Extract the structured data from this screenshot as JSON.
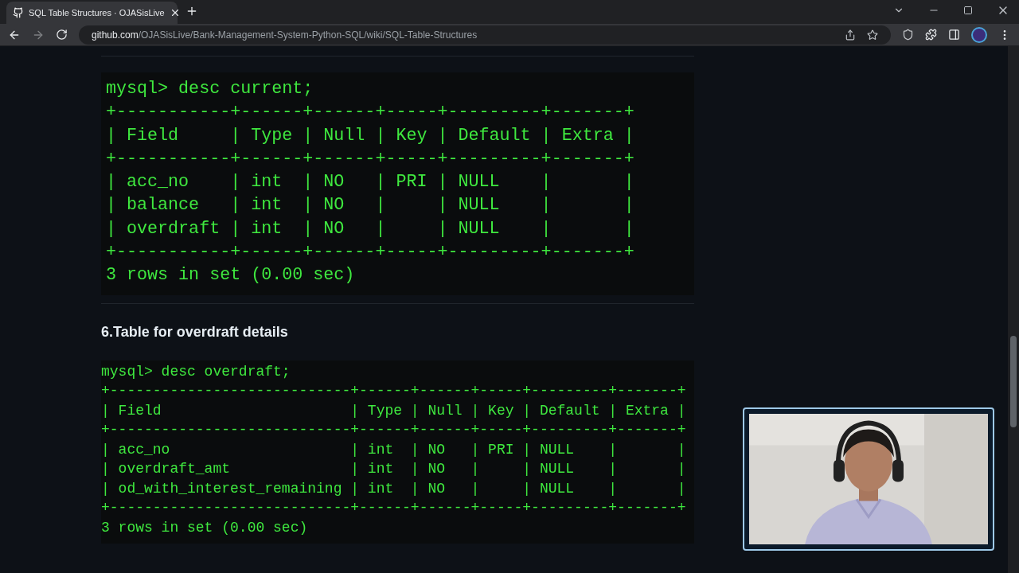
{
  "tabs": [
    {
      "title": "SQL Table Structures · OJASisLive",
      "selected": true
    }
  ],
  "address": {
    "host": "github.com",
    "path": "/OJASisLive/Bank-Management-System-Python-SQL/wiki/SQL-Table-Structures"
  },
  "sections": [
    {
      "kind": "large",
      "lines": [
        "mysql> desc current;",
        "+-----------+------+------+-----+---------+-------+",
        "| Field     | Type | Null | Key | Default | Extra |",
        "+-----------+------+------+-----+---------+-------+",
        "| acc_no    | int  | NO   | PRI | NULL    |       |",
        "| balance   | int  | NO   |     | NULL    |       |",
        "| overdraft | int  | NO   |     | NULL    |       |",
        "+-----------+------+------+-----+---------+-------+",
        "3 rows in set (0.00 sec)"
      ]
    },
    {
      "heading": "6.Table for overdraft details",
      "kind": "small",
      "lines": [
        "mysql> desc overdraft;",
        "+----------------------------+------+------+-----+---------+-------+",
        "| Field                      | Type | Null | Key | Default | Extra |",
        "+----------------------------+------+------+-----+---------+-------+",
        "| acc_no                     | int  | NO   | PRI | NULL    |       |",
        "| overdraft_amt              | int  | NO   |     | NULL    |       |",
        "| od_with_interest_remaining | int  | NO   |     | NULL    |       |",
        "+----------------------------+------+------+-----+---------+-------+",
        "3 rows in set (0.00 sec)"
      ]
    }
  ]
}
